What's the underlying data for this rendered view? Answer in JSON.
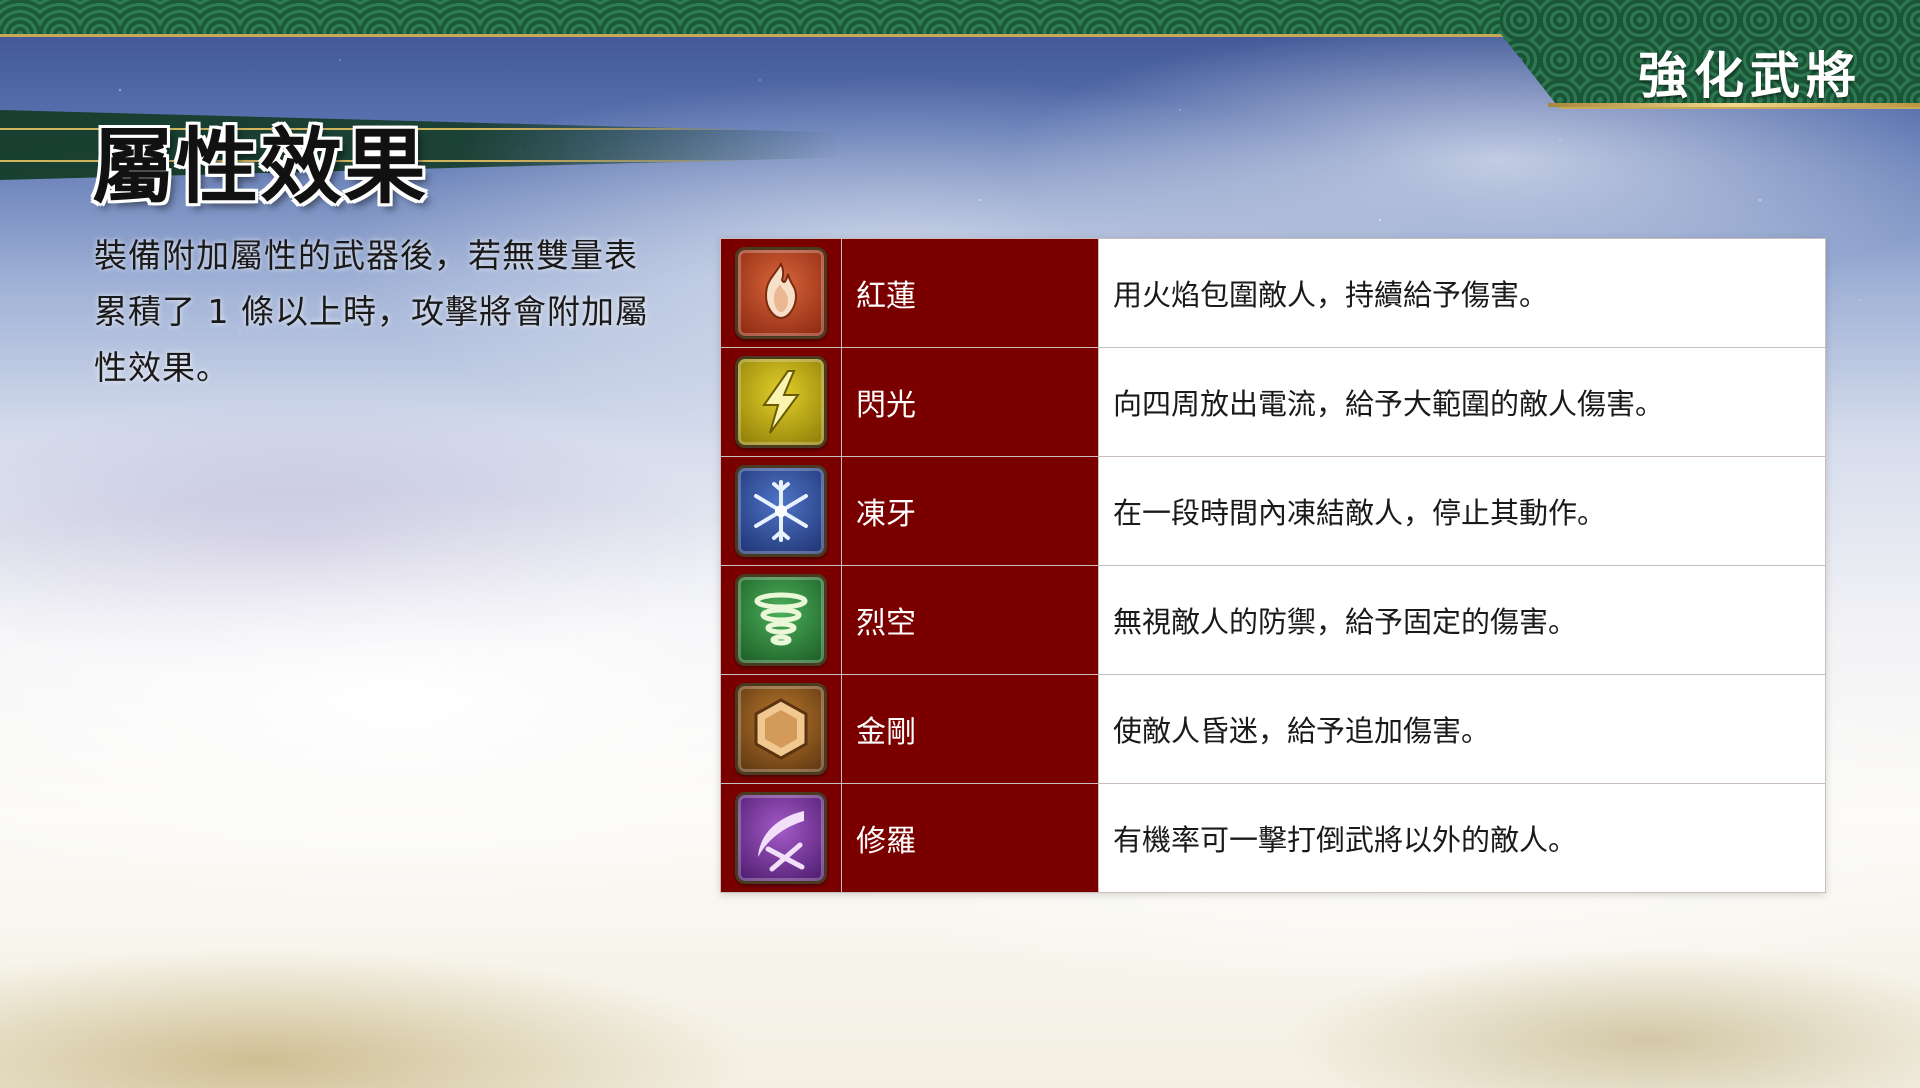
{
  "header": {
    "corner_title": "強化武將"
  },
  "page": {
    "title": "屬性效果",
    "description": "裝備附加屬性的武器後，若無雙量表累積了 1 條以上時，攻擊將會附加屬性效果。"
  },
  "effects": [
    {
      "name": "紅蓮",
      "description": "用火焰包圍敵人，持續給予傷害。",
      "icon": "fire-icon",
      "color": "#b8401a"
    },
    {
      "name": "閃光",
      "description": "向四周放出電流，給予大範圍的敵人傷害。",
      "icon": "lightning-icon",
      "color": "#9a8a10"
    },
    {
      "name": "凍牙",
      "description": "在一段時間內凍結敵人，停止其動作。",
      "icon": "snowflake-icon",
      "color": "#2f4f9a"
    },
    {
      "name": "烈空",
      "description": "無視敵人的防禦，給予固定的傷害。",
      "icon": "whirlwind-icon",
      "color": "#2e8a3a"
    },
    {
      "name": "金剛",
      "description": "使敵人昏迷，給予追加傷害。",
      "icon": "hexagon-icon",
      "color": "#8a5a1a"
    },
    {
      "name": "修羅",
      "description": "有機率可一擊打倒武將以外的敵人。",
      "icon": "slash-icon",
      "color": "#7a3a9a"
    }
  ]
}
